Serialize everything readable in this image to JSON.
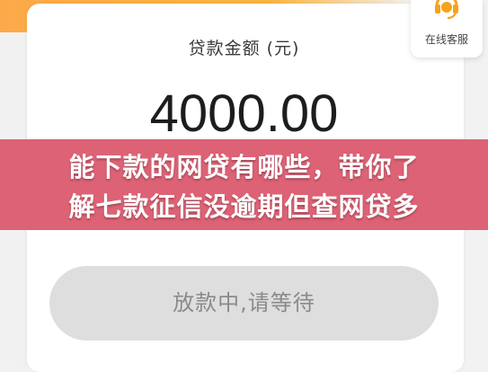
{
  "loan": {
    "amount_label": "贷款金额 (元)",
    "amount_value": "4000.00"
  },
  "service": {
    "label": "在线客服",
    "icon": "headset-icon"
  },
  "banner": {
    "line1": "能下款的网贷有哪些，带你了",
    "line2": "解七款征信没逾期但查网贷多"
  },
  "action": {
    "wait_label": "放款中,请等待"
  },
  "colors": {
    "accent_orange": "#fbb540",
    "banner_pink": "#dd6275",
    "button_disabled": "#dedede"
  }
}
